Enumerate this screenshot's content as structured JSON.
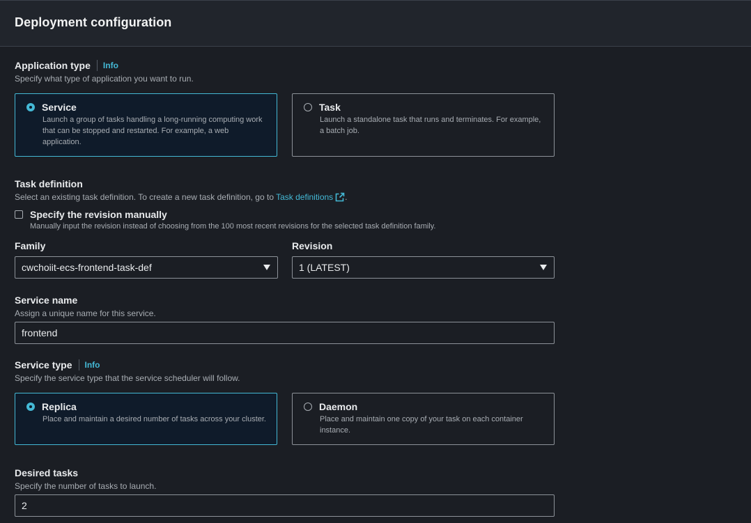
{
  "panel": {
    "title": "Deployment configuration"
  },
  "application_type": {
    "label": "Application type",
    "info": "Info",
    "description": "Specify what type of application you want to run.",
    "options": [
      {
        "title": "Service",
        "description": "Launch a group of tasks handling a long-running computing work that can be stopped and restarted. For example, a web application.",
        "selected": true
      },
      {
        "title": "Task",
        "description": "Launch a standalone task that runs and terminates. For example, a batch job.",
        "selected": false
      }
    ]
  },
  "task_definition": {
    "label": "Task definition",
    "description_prefix": "Select an existing task definition. To create a new task definition, go to",
    "link_text": "Task definitions",
    "description_suffix": ".",
    "external_icon": "external-link-icon",
    "manual_checkbox": {
      "label": "Specify the revision manually",
      "description": "Manually input the revision instead of choosing from the 100 most recent revisions for the selected task definition family.",
      "checked": false
    },
    "family": {
      "label": "Family",
      "value": "cwchoiit-ecs-frontend-task-def"
    },
    "revision": {
      "label": "Revision",
      "value": "1 (LATEST)"
    }
  },
  "service_name": {
    "label": "Service name",
    "description": "Assign a unique name for this service.",
    "value": "frontend"
  },
  "service_type": {
    "label": "Service type",
    "info": "Info",
    "description": "Specify the service type that the service scheduler will follow.",
    "options": [
      {
        "title": "Replica",
        "description": "Place and maintain a desired number of tasks across your cluster.",
        "selected": true
      },
      {
        "title": "Daemon",
        "description": "Place and maintain one copy of your task on each container instance.",
        "selected": false
      }
    ]
  },
  "desired_tasks": {
    "label": "Desired tasks",
    "description": "Specify the number of tasks to launch.",
    "value": "2"
  },
  "colors": {
    "accent": "#44b9d6",
    "background": "#1b1e24",
    "header": "#21252c",
    "selected_tile": "#0f1b2a"
  }
}
